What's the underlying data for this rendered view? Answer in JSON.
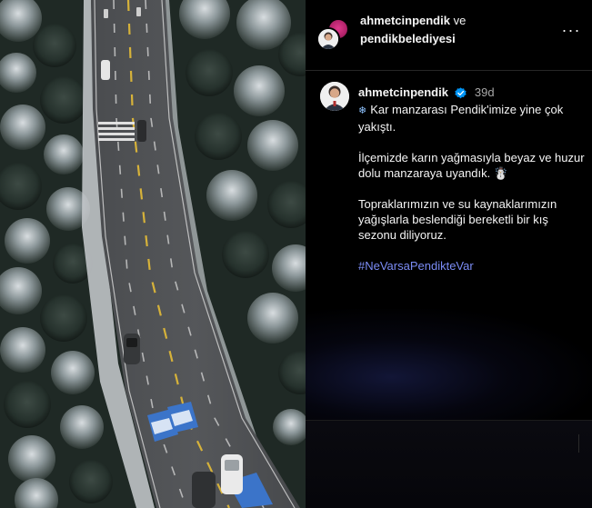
{
  "header": {
    "user1": "ahmetcinpendik",
    "conjunction": "ve",
    "user2": "pendikbelediyesi",
    "more_icon": "more-horizontal-icon"
  },
  "caption": {
    "username": "ahmetcinpendik",
    "verified_icon": "verified-badge-icon",
    "time": "39d",
    "snow_icon": "❄",
    "line1": "Kar manzarası Pendik'imize yine çok yakıştı.",
    "para2": "İlçemizde karın yağmasıyla beyaz ve huzur dolu manzaraya uyandık. ☃️",
    "para3": "Topraklarımızın ve su kaynaklarımızın yağışlarla beslendiği bereketli bir kış sezonu diliyoruz.",
    "hashtag": "#NeVarsaPendikteVar"
  },
  "colors": {
    "background": "#000000",
    "text": "#f5f5f5",
    "muted": "#a8a8a8",
    "hashtag": "#7b8cf5",
    "verified": "#0095f6"
  },
  "photo": {
    "description_icon": "aerial-snowy-road-image"
  }
}
